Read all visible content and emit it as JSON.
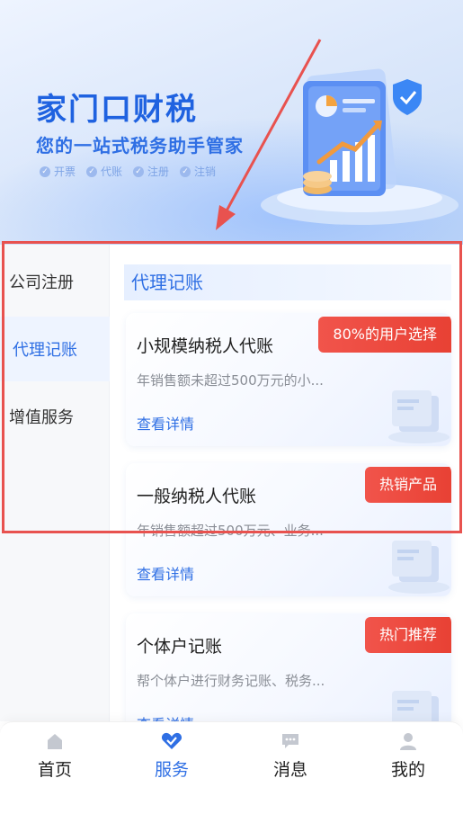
{
  "banner": {
    "title": "家门口财税",
    "subtitle": "您的一站式税务助手管家",
    "tags": [
      "开票",
      "代账",
      "注册",
      "注销"
    ]
  },
  "sidebar": {
    "items": [
      {
        "label": "公司注册",
        "active": false
      },
      {
        "label": "代理记账",
        "active": true
      },
      {
        "label": "增值服务",
        "active": false
      }
    ]
  },
  "content": {
    "section_title": "代理记账",
    "cards": [
      {
        "title": "小规模纳税人代账",
        "badge": "80%的用户选择",
        "desc": "年销售额未超过500万元的小...",
        "link": "查看详情"
      },
      {
        "title": "一般纳税人代账",
        "badge": "热销产品",
        "desc": "年销售额超过500万元、业务...",
        "link": "查看详情"
      },
      {
        "title": "个体户记账",
        "badge": "热门推荐",
        "desc": "帮个体户进行财务记账、税务...",
        "link": "查看详情"
      }
    ]
  },
  "tabbar": {
    "items": [
      {
        "label": "首页",
        "icon": "home-icon",
        "active": false
      },
      {
        "label": "服务",
        "icon": "service-icon",
        "active": true
      },
      {
        "label": "消息",
        "icon": "message-icon",
        "active": false
      },
      {
        "label": "我的",
        "icon": "profile-icon",
        "active": false
      }
    ]
  },
  "colors": {
    "accent": "#2f6fe4",
    "badge": "#e8483c",
    "highlight": "#e8524f"
  }
}
